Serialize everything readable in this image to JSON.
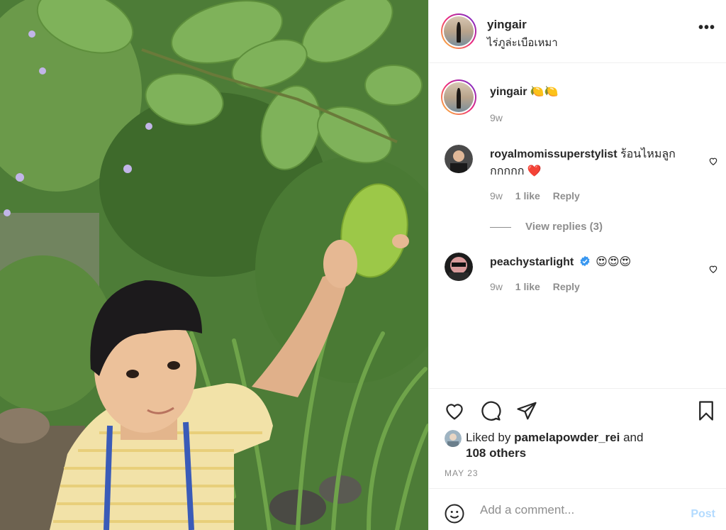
{
  "post": {
    "author": "yingair",
    "location": "ไร่ภูล่ะเบือเหมา",
    "more_label": "•••"
  },
  "caption": {
    "author": "yingair",
    "text": "🍋🍋",
    "time": "9w"
  },
  "comments": [
    {
      "author": "royalmomissuperstylist",
      "text": "ร้อนไหมลูกกกกกก ❤️",
      "time": "9w",
      "likes": "1 like",
      "reply_label": "Reply"
    },
    {
      "author": "peachystarlight",
      "verified": true,
      "text": "😍😍😍",
      "time": "9w",
      "likes": "1 like",
      "reply_label": "Reply"
    }
  ],
  "view_replies": "View replies (3)",
  "liked_by": {
    "prefix": "Liked by",
    "user": "pamelapowder_rei",
    "connector": "and",
    "others": "108 others"
  },
  "date": "MAY 23",
  "add_comment": {
    "placeholder": "Add a comment...",
    "post_label": "Post"
  },
  "colors": {
    "accent": "#0095f6",
    "post_disabled": "#b3dbff",
    "secondary_text": "#8e8e8e",
    "heart_red": "#ed4956"
  }
}
